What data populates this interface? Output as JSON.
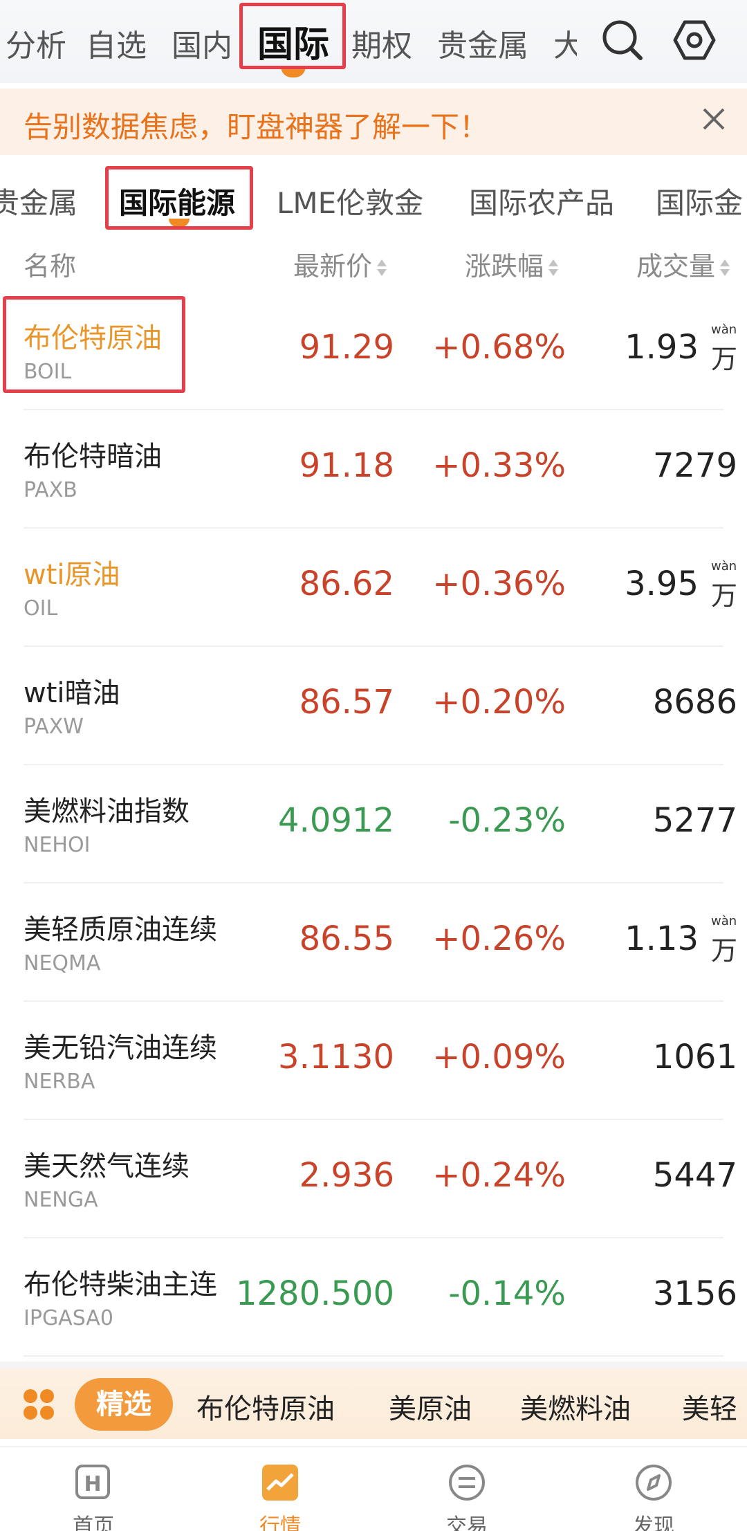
{
  "top_nav": {
    "tabs": [
      "分析",
      "自选",
      "国内",
      "国际",
      "期权",
      "贵金属",
      "大"
    ],
    "active": "国际"
  },
  "banner": {
    "text": "告别数据焦虑，盯盘神器了解一下！"
  },
  "sub_tabs": {
    "tabs": [
      "贵金属",
      "国际能源",
      "LME伦敦金",
      "国际农产品",
      "国际金"
    ],
    "active": "国际能源"
  },
  "table": {
    "headers": {
      "name": "名称",
      "price": "最新价",
      "change": "涨跌幅",
      "volume": "成交量"
    },
    "rows": [
      {
        "name": "布伦特原油",
        "code": "BOIL",
        "price": "91.29",
        "change": "+0.68%",
        "volume": "1.93",
        "unit": "万",
        "unit_pinyin": "wàn",
        "dir": "up",
        "highlight": true
      },
      {
        "name": "布伦特暗油",
        "code": "PAXB",
        "price": "91.18",
        "change": "+0.33%",
        "volume": "7279",
        "unit": "",
        "unit_pinyin": "",
        "dir": "up",
        "highlight": false
      },
      {
        "name": "wti原油",
        "code": "OIL",
        "price": "86.62",
        "change": "+0.36%",
        "volume": "3.95",
        "unit": "万",
        "unit_pinyin": "wàn",
        "dir": "up",
        "highlight": true
      },
      {
        "name": "wti暗油",
        "code": "PAXW",
        "price": "86.57",
        "change": "+0.20%",
        "volume": "8686",
        "unit": "",
        "unit_pinyin": "",
        "dir": "up",
        "highlight": false
      },
      {
        "name": "美燃料油指数",
        "code": "NEHOI",
        "price": "4.0912",
        "change": "-0.23%",
        "volume": "5277",
        "unit": "",
        "unit_pinyin": "",
        "dir": "down",
        "highlight": false
      },
      {
        "name": "美轻质原油连续",
        "code": "NEQMA",
        "price": "86.55",
        "change": "+0.26%",
        "volume": "1.13",
        "unit": "万",
        "unit_pinyin": "wàn",
        "dir": "up",
        "highlight": false
      },
      {
        "name": "美无铅汽油连续",
        "code": "NERBA",
        "price": "3.1130",
        "change": "+0.09%",
        "volume": "1061",
        "unit": "",
        "unit_pinyin": "",
        "dir": "up",
        "highlight": false
      },
      {
        "name": "美天然气连续",
        "code": "NENGA",
        "price": "2.936",
        "change": "+0.24%",
        "volume": "5447",
        "unit": "",
        "unit_pinyin": "",
        "dir": "up",
        "highlight": false
      },
      {
        "name": "布伦特柴油主连",
        "code": "IPGASA0",
        "price": "1280.500",
        "change": "-0.14%",
        "volume": "3156",
        "unit": "",
        "unit_pinyin": "",
        "dir": "down",
        "highlight": false
      }
    ]
  },
  "quick_bar": {
    "pill": "精选",
    "items": [
      "布伦特原油",
      "美原油",
      "美燃料油",
      "美轻"
    ]
  },
  "bottom_nav": {
    "items": [
      "首页",
      "行情",
      "交易",
      "发现"
    ],
    "active": "行情"
  },
  "colors": {
    "accent": "#f08a24",
    "up": "#c8432a",
    "down": "#3a9a52",
    "annotation": "#e5404a"
  }
}
